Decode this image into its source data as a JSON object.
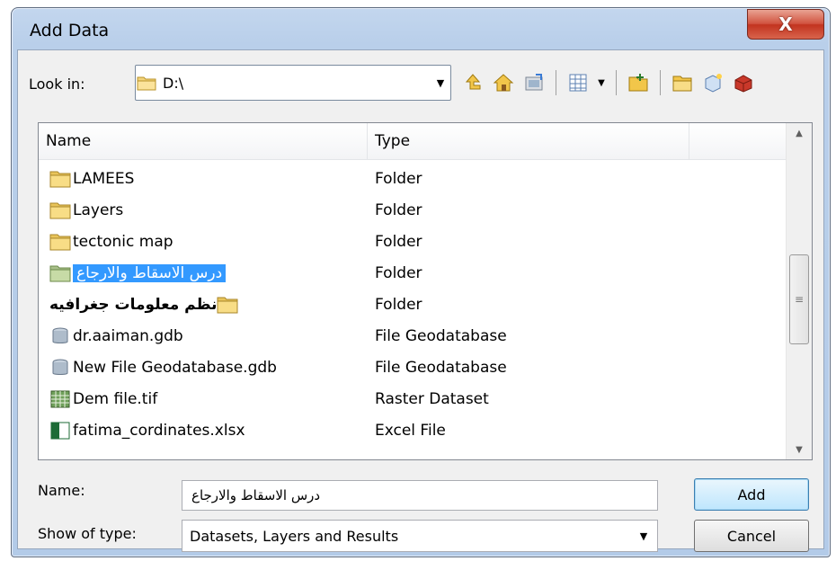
{
  "window": {
    "title": "Add Data",
    "close_glyph": "X"
  },
  "look_in": {
    "label": "Look in:",
    "value": "D:\\"
  },
  "toolbar": {
    "icons": [
      "up-one-level-icon",
      "home-icon",
      "connect-folder-icon",
      "view-list-icon",
      "new-folder-icon",
      "folder-icon",
      "new-item-icon",
      "toolbox-icon"
    ]
  },
  "list": {
    "columns": [
      "Name",
      "Type"
    ],
    "rows": [
      {
        "name": "LAMEES",
        "type": "Folder",
        "icon": "folder-icon"
      },
      {
        "name": "Layers",
        "type": "Folder",
        "icon": "folder-icon"
      },
      {
        "name": "tectonic map",
        "type": "Folder",
        "icon": "folder-icon"
      },
      {
        "name": "درس الاسقاط والارجاع",
        "type": "Folder",
        "icon": "folder-icon"
      },
      {
        "name": "نظم معلومات جغرافيه",
        "type": "Folder",
        "icon": "folder-icon"
      },
      {
        "name": "dr.aaiman.gdb",
        "type": "File Geodatabase",
        "icon": "geodatabase-icon"
      },
      {
        "name": "New File Geodatabase.gdb",
        "type": "File Geodatabase",
        "icon": "geodatabase-icon"
      },
      {
        "name": "Dem file.tif",
        "type": "Raster Dataset",
        "icon": "raster-icon"
      },
      {
        "name": "fatima_cordinates.xlsx",
        "type": "Excel File",
        "icon": "excel-icon"
      }
    ]
  },
  "name_field": {
    "label": "Name:",
    "value": "درس الاسقاط والارجاع"
  },
  "type_field": {
    "label": "Show of type:",
    "value": "Datasets, Layers and Results"
  },
  "buttons": {
    "add": "Add",
    "cancel": "Cancel"
  },
  "colors": {
    "selection": "#3399ff",
    "title_bar": "#b9cfea",
    "close": "#c2331f"
  }
}
